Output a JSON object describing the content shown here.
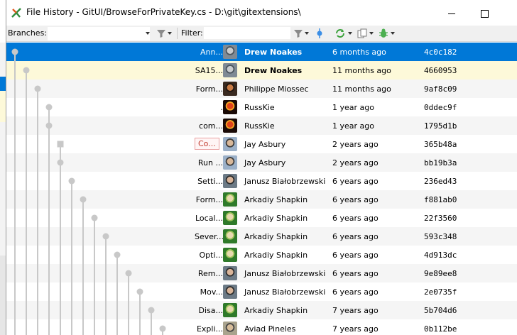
{
  "window": {
    "title": "File History - GitUI/BrowseForPrivateKey.cs - D:\\git\\gitextensions\\",
    "icon": "gitextensions-icon"
  },
  "toolbar": {
    "branches_label": "Branches:",
    "filter_label": "Filter:",
    "branches_value": "",
    "filter_value": ""
  },
  "colors": {
    "selected_row": "#0078d7",
    "highlight_row": "#fdf9d9",
    "alt_row": "#f5f5f5",
    "graph_line": "#c8c8c8",
    "tag_border": "#e8a0a0"
  },
  "commits": [
    {
      "message": "Ann...",
      "author": "Drew Noakes",
      "date": "6 months ago",
      "hash": "4c0c182",
      "state": "selected",
      "bold": true,
      "avatar": "photo-grey"
    },
    {
      "message": "SA15...",
      "author": "Drew Noakes",
      "date": "11 months ago",
      "hash": "4660953",
      "state": "highlight",
      "bold": true,
      "avatar": "photo-grey"
    },
    {
      "message": "Form...",
      "author": "Philippe Miossec",
      "date": "11 months ago",
      "hash": "9af8c09",
      "state": "",
      "bold": false,
      "avatar": "photo-dark"
    },
    {
      "message": ".",
      "author": "RussKie",
      "date": "1 year ago",
      "hash": "0ddec9f",
      "state": "",
      "bold": false,
      "avatar": "photo-red"
    },
    {
      "message": "com...",
      "author": "RussKie",
      "date": "1 year ago",
      "hash": "1795d1b",
      "state": "",
      "bold": false,
      "avatar": "photo-red"
    },
    {
      "message": "",
      "tag": "Co...",
      "author": "Jay Asbury",
      "date": "2 years ago",
      "hash": "365b48a",
      "state": "",
      "bold": false,
      "avatar": "photo-person"
    },
    {
      "message": "Run ...",
      "author": "Jay Asbury",
      "date": "2 years ago",
      "hash": "bb19b3a",
      "state": "",
      "bold": false,
      "avatar": "photo-person"
    },
    {
      "message": "Setti...",
      "author": "Janusz Białobrzewski",
      "date": "6 years ago",
      "hash": "236ed43",
      "state": "",
      "bold": false,
      "avatar": "photo-person2"
    },
    {
      "message": "Form...",
      "author": "Arkadiy Shapkin",
      "date": "6 years ago",
      "hash": "f881ab0",
      "state": "",
      "bold": false,
      "avatar": "photo-green"
    },
    {
      "message": "Local...",
      "author": "Arkadiy Shapkin",
      "date": "6 years ago",
      "hash": "22f3560",
      "state": "",
      "bold": false,
      "avatar": "photo-green"
    },
    {
      "message": "Sever...",
      "author": "Arkadiy Shapkin",
      "date": "6 years ago",
      "hash": "593c348",
      "state": "",
      "bold": false,
      "avatar": "photo-green"
    },
    {
      "message": "Opti...",
      "author": "Arkadiy Shapkin",
      "date": "6 years ago",
      "hash": "4d913dc",
      "state": "",
      "bold": false,
      "avatar": "photo-green"
    },
    {
      "message": "Rem...",
      "author": "Janusz Białobrzewski",
      "date": "6 years ago",
      "hash": "9e89ee8",
      "state": "",
      "bold": false,
      "avatar": "photo-person2"
    },
    {
      "message": "Mov...",
      "author": "Janusz Białobrzewski",
      "date": "6 years ago",
      "hash": "2e0735f",
      "state": "",
      "bold": false,
      "avatar": "photo-person2"
    },
    {
      "message": "Disa...",
      "author": "Arkadiy Shapkin",
      "date": "7 years ago",
      "hash": "5b704d6",
      "state": "",
      "bold": false,
      "avatar": "photo-green"
    },
    {
      "message": "Expli...",
      "author": "Aviad Pineles",
      "date": "7 years ago",
      "hash": "0b112be",
      "state": "",
      "bold": false,
      "avatar": "photo-person3"
    }
  ]
}
